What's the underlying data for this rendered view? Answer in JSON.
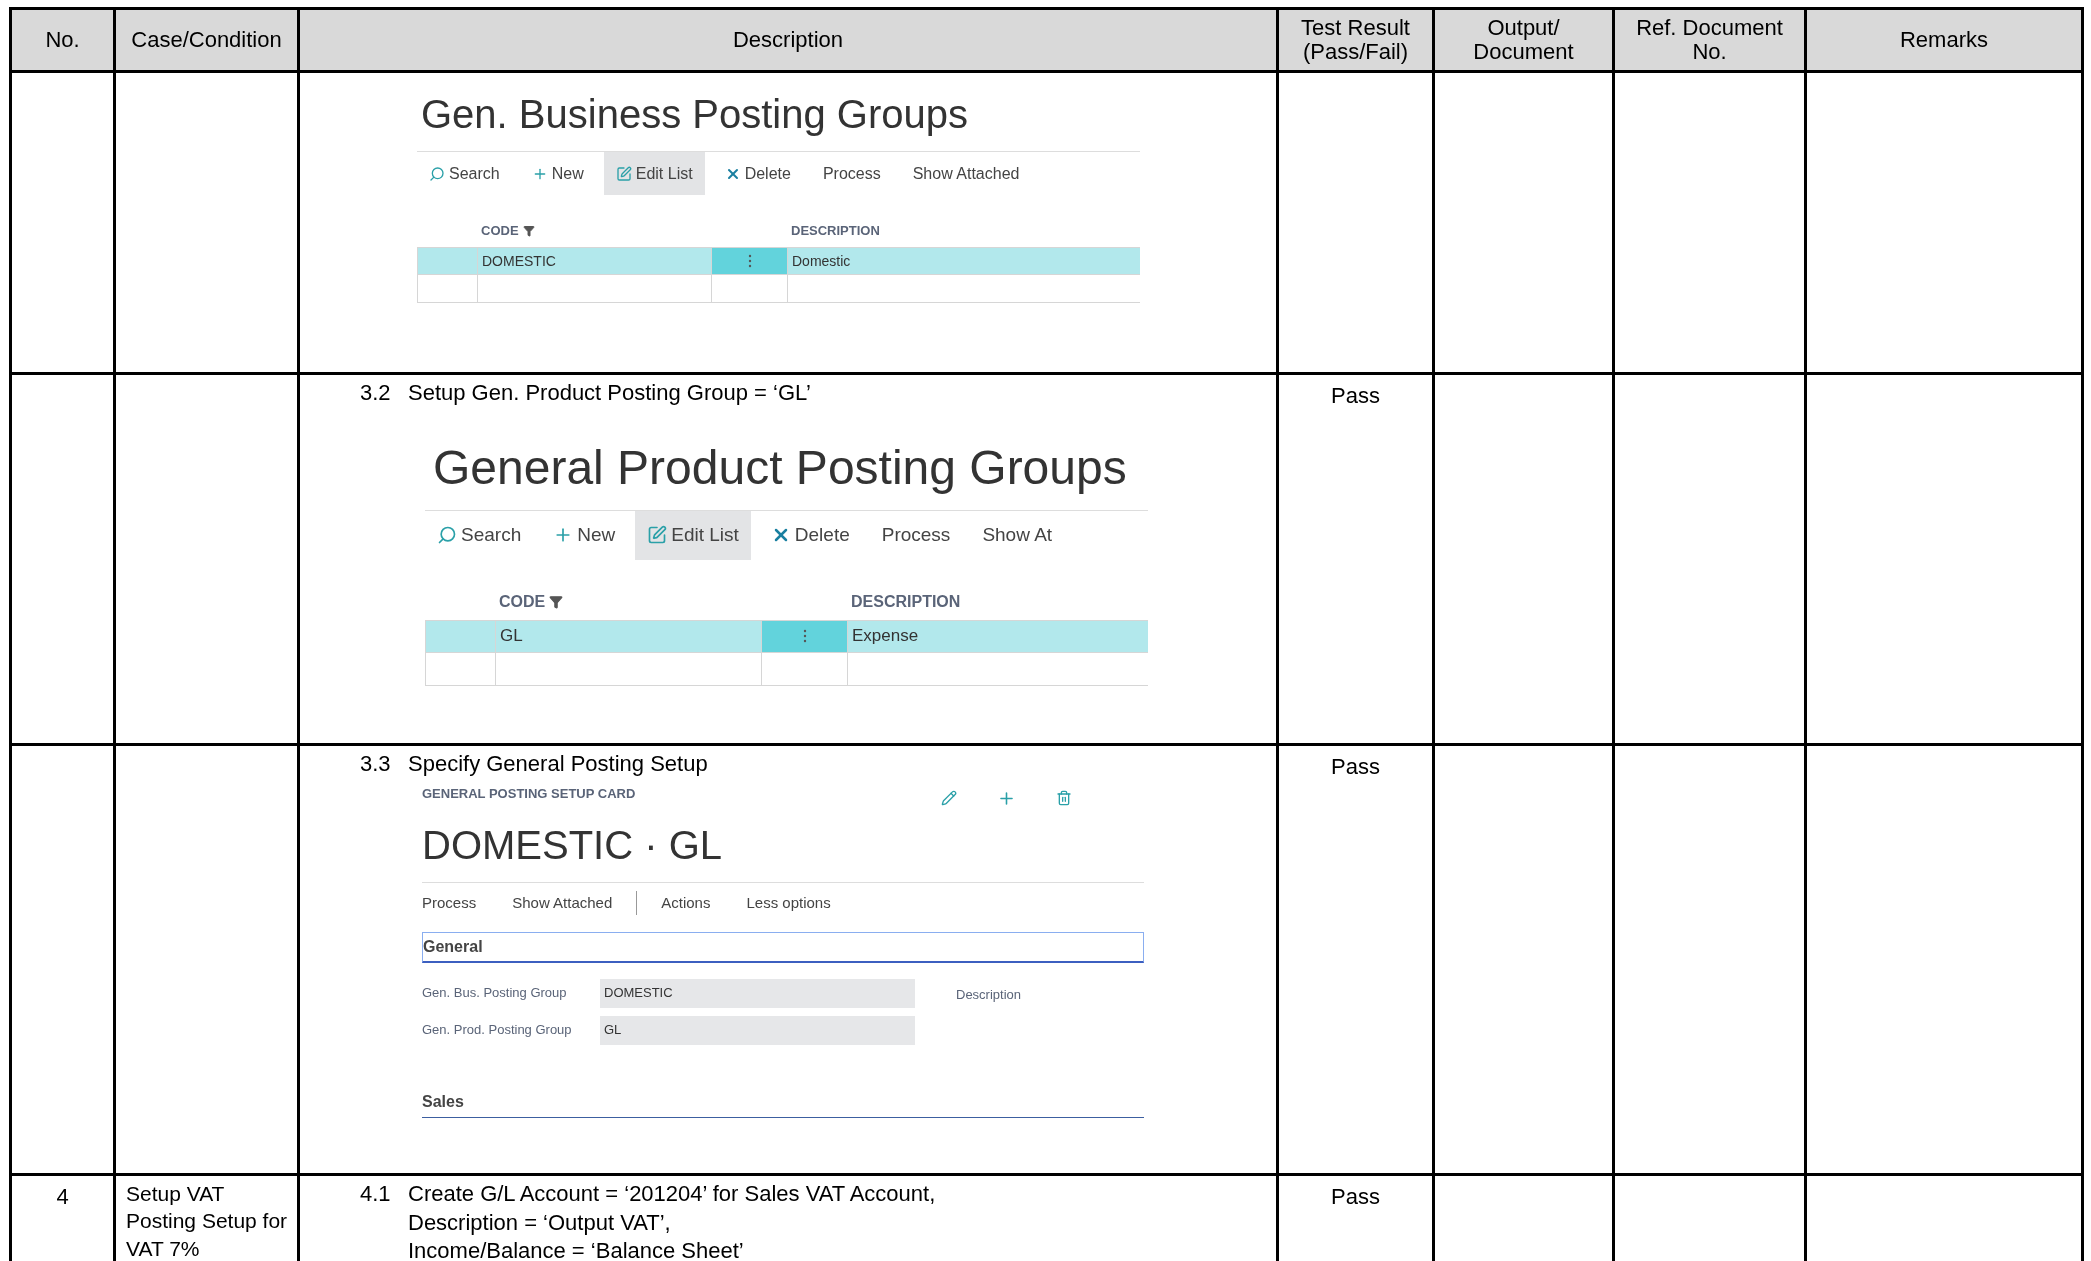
{
  "table": {
    "columns": [
      {
        "lines": [
          "No."
        ]
      },
      {
        "lines": [
          "Case/Condition"
        ]
      },
      {
        "lines": [
          "Description"
        ]
      },
      {
        "lines": [
          "Test Result",
          "(Pass/Fail)"
        ]
      },
      {
        "lines": [
          "Output/",
          "Document"
        ]
      },
      {
        "lines": [
          "Ref. Document",
          "No."
        ]
      },
      {
        "lines": [
          "Remarks"
        ]
      }
    ],
    "rows": [
      {
        "description": {
          "screenshot": {
            "kind": "list",
            "title": "Gen. Business Posting Groups",
            "actions": [
              {
                "label": "Search",
                "selected": false
              },
              {
                "label": "New",
                "selected": false
              },
              {
                "label": "Edit List",
                "selected": true
              },
              {
                "label": "Delete",
                "selected": false
              },
              {
                "label": "Process",
                "selected": false
              },
              {
                "label": "Show Attached",
                "selected": false
              }
            ],
            "columns": [
              {
                "label": "CODE",
                "filtered": true
              },
              {
                "label": "DESCRIPTION",
                "filtered": false
              }
            ],
            "rows": [
              {
                "code": "DOMESTIC",
                "description": "Domestic",
                "selected": true
              }
            ]
          }
        }
      },
      {
        "description": {
          "step_no": "3.2",
          "lines": [
            "Setup Gen. Product Posting Group = ‘GL’"
          ],
          "screenshot": {
            "kind": "list",
            "title": "General Product Posting Groups",
            "actions": [
              {
                "label": "Search",
                "selected": false
              },
              {
                "label": "New",
                "selected": false
              },
              {
                "label": "Edit List",
                "selected": true
              },
              {
                "label": "Delete",
                "selected": false
              },
              {
                "label": "Process",
                "selected": false
              },
              {
                "label": "Show At",
                "selected": false
              }
            ],
            "columns": [
              {
                "label": "CODE",
                "filtered": true
              },
              {
                "label": "DESCRIPTION",
                "filtered": false
              }
            ],
            "rows": [
              {
                "code": "GL",
                "description": "Expense",
                "selected": true
              }
            ]
          }
        },
        "test_result": "Pass"
      },
      {
        "description": {
          "step_no": "3.3",
          "lines": [
            "Specify General Posting Setup"
          ],
          "screenshot": {
            "kind": "card",
            "caption": "GENERAL POSTING SETUP CARD",
            "title": "DOMESTIC · GL",
            "actions": [
              "Process",
              "Show Attached",
              "Actions",
              "Less options"
            ],
            "sections": [
              {
                "title": "General",
                "focused": true,
                "fields": [
                  {
                    "label": "Gen. Bus. Posting Group",
                    "value": "DOMESTIC"
                  },
                  {
                    "label": "Gen. Prod. Posting Group",
                    "value": "GL"
                  }
                ],
                "side_label": "Description"
              },
              {
                "title": "Sales",
                "focused": false
              }
            ]
          }
        },
        "test_result": "Pass"
      },
      {
        "no": "4",
        "case_condition": "Setup VAT Posting Setup for VAT 7%",
        "description": {
          "step_no": "4.1",
          "lines": [
            "Create G/L Account = ‘201204’ for Sales VAT Account,",
            "Description = ‘Output VAT’,",
            "Income/Balance = ‘Balance Sheet’"
          ]
        },
        "test_result": "Pass"
      }
    ]
  }
}
